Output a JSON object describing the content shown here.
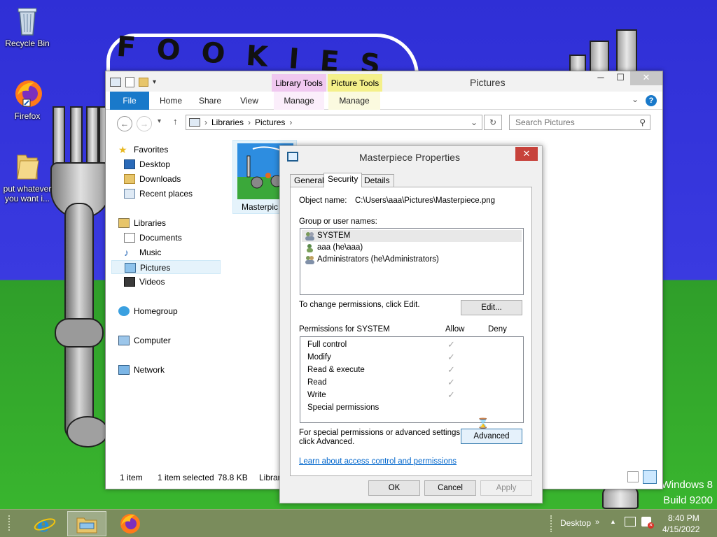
{
  "desktop": {
    "icons": [
      {
        "label": "Recycle Bin"
      },
      {
        "label": "Firefox"
      },
      {
        "label": "put whatever you want i..."
      }
    ],
    "watermark": [
      "Windows 8",
      "Build 9200"
    ]
  },
  "explorer": {
    "title": "Pictures",
    "contextual_tabs": {
      "library_tools": "Library Tools",
      "picture_tools": "Picture Tools"
    },
    "ribbon_tabs": [
      "File",
      "Home",
      "Share",
      "View",
      "Manage",
      "Manage"
    ],
    "help_label": "?",
    "breadcrumb": [
      "Libraries",
      "Pictures"
    ],
    "search_placeholder": "Search Pictures",
    "nav": {
      "favorites": "Favorites",
      "desktop": "Desktop",
      "downloads": "Downloads",
      "recent": "Recent places",
      "libraries": "Libraries",
      "documents": "Documents",
      "music": "Music",
      "pictures": "Pictures",
      "videos": "Videos",
      "homegroup": "Homegroup",
      "computer": "Computer",
      "network": "Network"
    },
    "file_item": {
      "name": "Masterpic"
    },
    "status": {
      "items": "1 item",
      "selected": "1 item selected",
      "size": "78.8 KB",
      "extra": "Librar"
    }
  },
  "dialog": {
    "title": "Masterpiece Properties",
    "close_label": "✕",
    "tabs": [
      "General",
      "Security",
      "Details"
    ],
    "object_name_label": "Object name:",
    "object_name_value": "C:\\Users\\aaa\\Pictures\\Masterpiece.png",
    "group_label": "Group or user names:",
    "users": [
      "SYSTEM",
      "aaa (he\\aaa)",
      "Administrators (he\\Administrators)"
    ],
    "change_text": "To change permissions, click Edit.",
    "edit_button": "Edit...",
    "permissions_for": "Permissions for SYSTEM",
    "allow_label": "Allow",
    "deny_label": "Deny",
    "permissions": [
      {
        "name": "Full control",
        "allow": true
      },
      {
        "name": "Modify",
        "allow": true
      },
      {
        "name": "Read & execute",
        "allow": true
      },
      {
        "name": "Read",
        "allow": true
      },
      {
        "name": "Write",
        "allow": true
      },
      {
        "name": "Special permissions",
        "allow": false
      }
    ],
    "special_text_1": "For special permissions or advanced settings,",
    "special_text_2": "click Advanced.",
    "advanced_button": "Advanced",
    "learn_link": "Learn about access control and permissions",
    "ok_button": "OK",
    "cancel_button": "Cancel",
    "apply_button": "Apply"
  },
  "taskbar": {
    "desktop_label": "Desktop",
    "time": "8:40 PM",
    "date": "4/15/2022"
  },
  "colors": {
    "accent": "#1979ca",
    "taskbar": "#7a8c5c",
    "close_red": "#c7423b",
    "library_tools": "#f0c8f0",
    "picture_tools": "#f4f08a"
  }
}
